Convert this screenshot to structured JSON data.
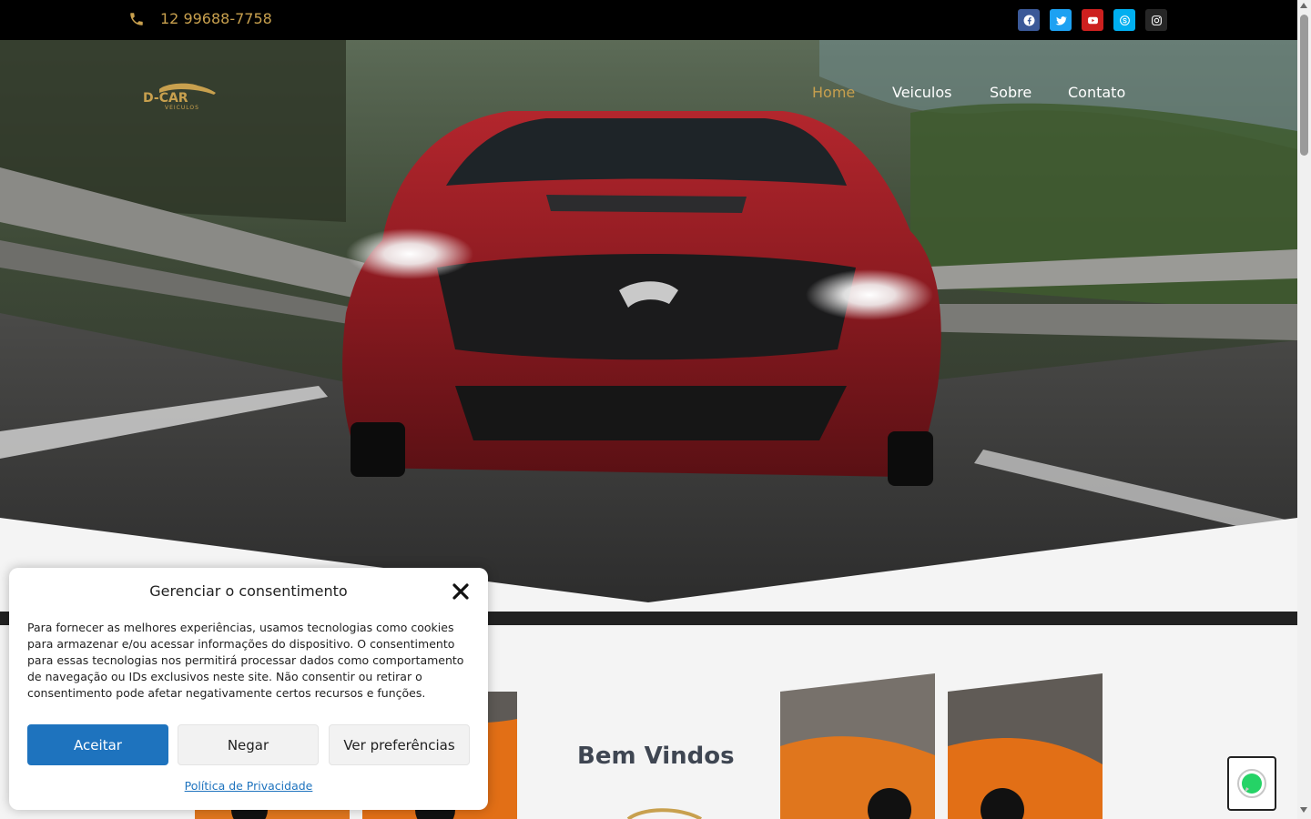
{
  "topbar": {
    "phone": "12 99688-7758",
    "phone_icon": "phone-icon",
    "social": [
      {
        "name": "facebook-icon",
        "color": "#3b5998"
      },
      {
        "name": "twitter-icon",
        "color": "#1da1f2"
      },
      {
        "name": "youtube-icon",
        "color": "#cd201f"
      },
      {
        "name": "skype-icon",
        "color": "#00aff0"
      },
      {
        "name": "instagram-icon",
        "color": "#262626"
      }
    ]
  },
  "header": {
    "logo_text": "D-CAR",
    "logo_subtext": "VEICULOS",
    "nav": [
      "Home",
      "Veiculos",
      "Sobre",
      "Contato"
    ],
    "active_nav": "Home"
  },
  "main": {
    "welcome_title": "Bem Vindos"
  },
  "consent": {
    "title": "Gerenciar o consentimento",
    "body": "Para fornecer as melhores experiências, usamos tecnologias como cookies para armazenar e/ou acessar informações do dispositivo. O consentimento para essas tecnologias nos permitirá processar dados como comportamento de navegação ou IDs exclusivos neste site. Não consentir ou retirar o consentimento pode afetar negativamente certos recursos e funções.",
    "accept_label": "Aceitar",
    "deny_label": "Negar",
    "prefs_label": "Ver preferências",
    "privacy_label": "Política de Privacidade"
  },
  "colors": {
    "accent": "#c8a04e",
    "primary_button": "#1e73be",
    "whatsapp": "#25d366"
  }
}
